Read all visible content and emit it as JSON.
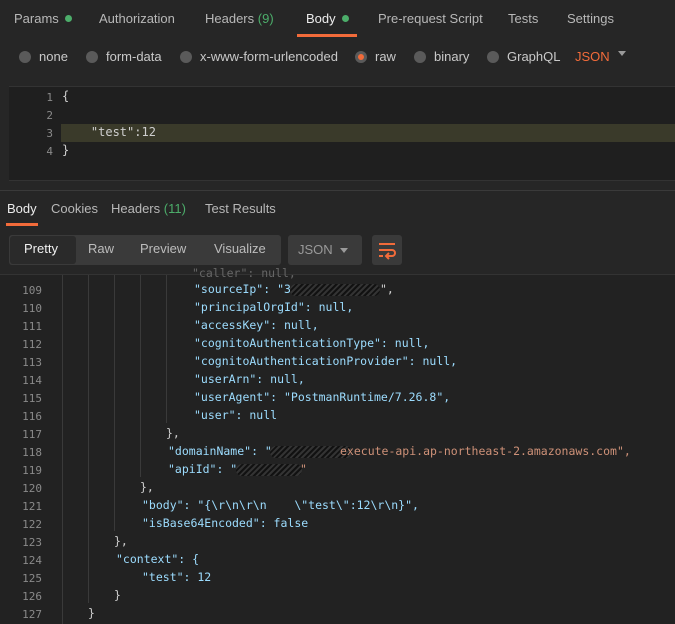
{
  "request_tabs": [
    {
      "label": "Params",
      "dot": true
    },
    {
      "label": "Authorization"
    },
    {
      "label": "Headers",
      "count": "(9)"
    },
    {
      "label": "Body",
      "dot": true,
      "active": true
    },
    {
      "label": "Pre-request Script"
    },
    {
      "label": "Tests"
    },
    {
      "label": "Settings"
    }
  ],
  "body_types": [
    {
      "label": "none"
    },
    {
      "label": "form-data"
    },
    {
      "label": "x-www-form-urlencoded"
    },
    {
      "label": "raw",
      "selected": true
    },
    {
      "label": "binary"
    },
    {
      "label": "GraphQL"
    }
  ],
  "body_format": "JSON",
  "editor": {
    "line_numbers": [
      "1",
      "2",
      "3",
      "4"
    ],
    "lines": [
      "{",
      "",
      "    \"test\":12",
      "}"
    ]
  },
  "response_tabs": [
    {
      "label": "Body",
      "active": true
    },
    {
      "label": "Cookies"
    },
    {
      "label": "Headers",
      "count": "(11)"
    },
    {
      "label": "Test Results"
    }
  ],
  "view_modes": [
    "Pretty",
    "Raw",
    "Preview",
    "Visualize"
  ],
  "response_format": "JSON",
  "response_lines": [
    {
      "n": "109",
      "text": "\"sourceIp\": \"3",
      "tail": "\","
    },
    {
      "n": "110",
      "text": "\"principalOrgId\": null,"
    },
    {
      "n": "111",
      "text": "\"accessKey\": null,"
    },
    {
      "n": "112",
      "text": "\"cognitoAuthenticationType\": null,"
    },
    {
      "n": "113",
      "text": "\"cognitoAuthenticationProvider\": null,"
    },
    {
      "n": "114",
      "text": "\"userArn\": null,"
    },
    {
      "n": "115",
      "text": "\"userAgent\": \"PostmanRuntime/7.26.8\","
    },
    {
      "n": "116",
      "text": "\"user\": null"
    },
    {
      "n": "117",
      "text": "},"
    },
    {
      "n": "118",
      "text": "\"domainName\": \"",
      "tail": "execute-api.ap-northeast-2.amazonaws.com\","
    },
    {
      "n": "119",
      "text": "\"apiId\": \"",
      "tail": "\""
    },
    {
      "n": "120",
      "text": "},"
    },
    {
      "n": "121",
      "text": "\"body\": \"{\\r\\n\\r\\n    \\\"test\\\":12\\r\\n}\","
    },
    {
      "n": "122",
      "text": "\"isBase64Encoded\": false"
    },
    {
      "n": "123",
      "text": "},"
    },
    {
      "n": "124",
      "text": "\"context\": {"
    },
    {
      "n": "125",
      "text": "\"test\": 12"
    },
    {
      "n": "126",
      "text": "}"
    },
    {
      "n": "127",
      "text": "}"
    }
  ],
  "colors": {
    "accent": "#f26b3a",
    "ok": "#4cad6a",
    "bg": "#262626"
  }
}
